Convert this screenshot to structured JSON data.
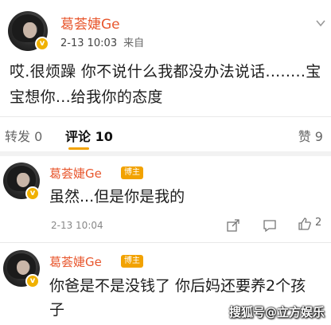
{
  "post": {
    "author": "葛荟婕Ge",
    "time": "2-13 10:03",
    "source": "来自",
    "text": "哎.很烦躁 你不说什么我都没办法说话........宝宝想你...给我你的态度"
  },
  "tabs": {
    "repost": "转发 0",
    "comment": "评论 10",
    "like": "赞 9"
  },
  "comments": [
    {
      "author": "葛荟婕Ge",
      "tag": "博主",
      "text": "虽然...但是你是我的",
      "time": "2-13 10:04",
      "likes": "2"
    },
    {
      "author": "葛荟婕Ge",
      "tag": "博主",
      "text": "你爸是不是没钱了 你后妈还要养2个孩子"
    }
  ],
  "watermark": "搜狐号@立方娱乐",
  "colors": {
    "name": "#e8572e",
    "accent": "#f2a200"
  },
  "icons": [
    "verified-icon",
    "chevron-down-icon",
    "share-icon",
    "comment-icon",
    "like-icon"
  ]
}
